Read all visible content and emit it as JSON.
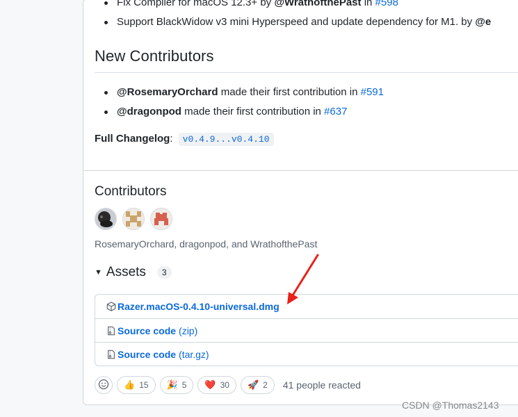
{
  "release_notes": {
    "bullets": [
      {
        "text_pre": "Fix Compiler for macOS 12.3+ by ",
        "author": "@WrathofthePast",
        "text_mid": " in ",
        "pr": "#598"
      },
      {
        "text_pre": "Support BlackWidow v3 mini Hyperspeed and update dependency for M1. by ",
        "author": "@e"
      }
    ]
  },
  "new_contributors": {
    "heading": "New Contributors",
    "items": [
      {
        "author": "@RosemaryOrchard",
        "text": " made their first contribution in ",
        "pr": "#591"
      },
      {
        "author": "@dragonpod",
        "text": " made their first contribution in ",
        "pr": "#637"
      }
    ]
  },
  "changelog": {
    "label": "Full Changelog",
    "colon": ":",
    "range": "v0.4.9...v0.4.10"
  },
  "contributors": {
    "heading": "Contributors",
    "names": "RosemaryOrchard, dragonpod, and WrathofthePast"
  },
  "assets": {
    "heading": "Assets",
    "count": "3",
    "files": [
      {
        "name": "Razer.macOS-0.4.10-universal.dmg",
        "sub": "",
        "icon": "package-icon"
      },
      {
        "name": "Source code",
        "sub": "(zip)",
        "icon": "file-zip-icon"
      },
      {
        "name": "Source code",
        "sub": "(tar.gz)",
        "icon": "file-zip-icon"
      }
    ]
  },
  "reactions": {
    "items": [
      {
        "emoji": "👍",
        "count": "15",
        "name": "thumbs-up"
      },
      {
        "emoji": "🎉",
        "count": "5",
        "name": "hooray"
      },
      {
        "emoji": "❤️",
        "count": "30",
        "name": "heart"
      },
      {
        "emoji": "🚀",
        "count": "2",
        "name": "rocket"
      }
    ],
    "summary": "41 people reacted"
  },
  "watermark": "CSDN @Thomas2143",
  "colors": {
    "link": "#0969da",
    "border": "#d0d7de",
    "arrow": "#e8221a"
  }
}
